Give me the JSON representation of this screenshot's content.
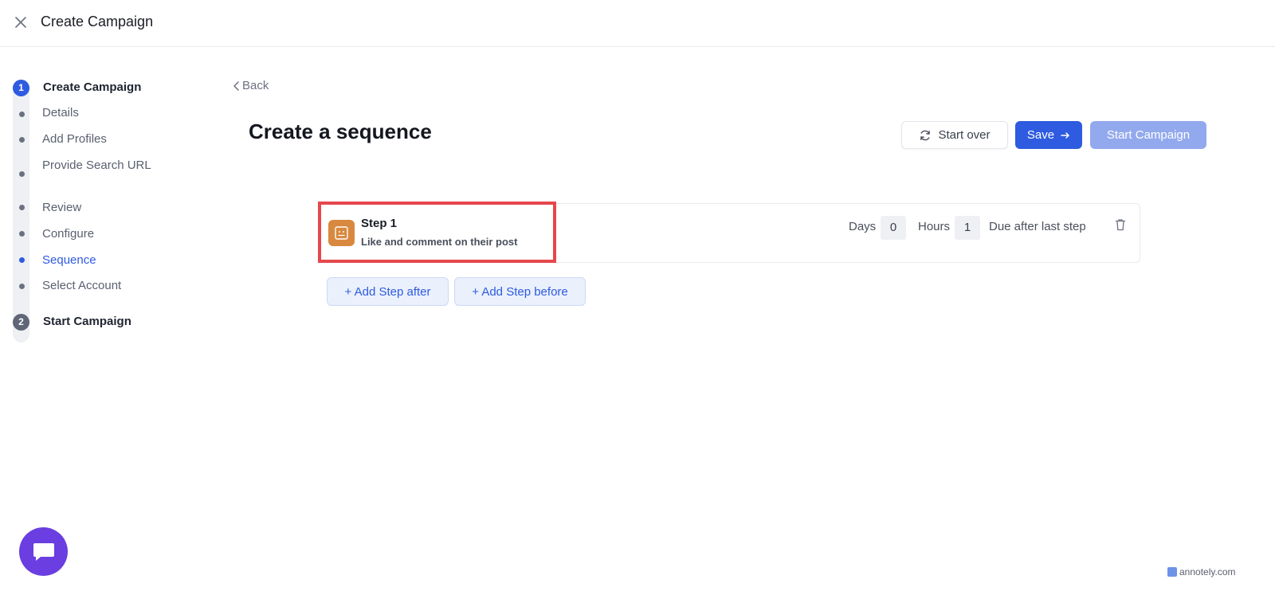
{
  "header": {
    "title": "Create Campaign"
  },
  "stepper": {
    "steps": [
      {
        "number": "1",
        "label": "Create Campaign",
        "substeps": [
          {
            "label": "Details"
          },
          {
            "label": "Add Profiles"
          },
          {
            "label": "Provide Search URL"
          },
          {
            "label": "Review"
          },
          {
            "label": "Configure"
          },
          {
            "label": "Sequence"
          },
          {
            "label": "Select Account"
          }
        ]
      },
      {
        "number": "2",
        "label": "Start Campaign"
      }
    ],
    "active_substep": "Sequence"
  },
  "main": {
    "back_label": "Back",
    "title": "Create a sequence",
    "buttons": {
      "start_over": "Start over",
      "save": "Save",
      "start_campaign": "Start Campaign"
    },
    "sequence": [
      {
        "title": "Step 1",
        "description": "Like and comment on their post",
        "days_label": "Days",
        "days": "0",
        "hours_label": "Hours",
        "hours": "1",
        "due_label": "Due after last step"
      }
    ],
    "add_step_after": "+ Add Step after",
    "add_step_before": "+ Add Step before"
  },
  "watermark": "annotely.com",
  "colors": {
    "primary": "#2e5be0",
    "primary_disabled": "#93a9ee",
    "step_icon": "#d9883f",
    "highlight": "#e5474c",
    "chat": "#6a3ee0"
  },
  "icons": {
    "close": "close-icon",
    "back": "chevron-left-icon",
    "refresh": "refresh-icon",
    "arrow": "arrow-right-icon",
    "step": "engage-icon",
    "delete": "trash-icon",
    "chat": "chat-icon"
  }
}
